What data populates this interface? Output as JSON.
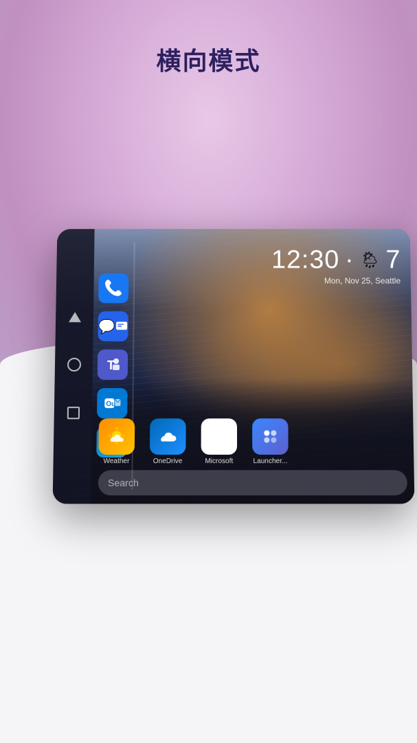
{
  "title": "横向模式",
  "clock": {
    "time": "12:30",
    "separator": "·",
    "temperature": "7",
    "date_location": "Mon, Nov 25, Seattle"
  },
  "nav_buttons": [
    {
      "id": "triangle",
      "label": "back",
      "shape": "triangle"
    },
    {
      "id": "circle",
      "label": "home",
      "shape": "circle"
    },
    {
      "id": "square",
      "label": "recents",
      "shape": "square"
    }
  ],
  "sidebar_apps": [
    {
      "id": "phone",
      "label": "Phone"
    },
    {
      "id": "messages",
      "label": "Messages"
    },
    {
      "id": "teams",
      "label": "Teams"
    },
    {
      "id": "outlook",
      "label": "Outlook"
    },
    {
      "id": "edge",
      "label": "Edge"
    }
  ],
  "dock_apps": [
    {
      "id": "weather",
      "label": "Weather"
    },
    {
      "id": "onedrive",
      "label": "OneDrive"
    },
    {
      "id": "microsoft",
      "label": "Microsoft"
    },
    {
      "id": "launcher",
      "label": "Launcher..."
    }
  ],
  "search": {
    "placeholder": "Search"
  },
  "weather_icon": "🌦",
  "colors": {
    "bg_top": "#d4a8d4",
    "bg_bottom": "#f5f5f7",
    "title": "#2d2060",
    "mockup_bg": "#1a1a2e"
  }
}
